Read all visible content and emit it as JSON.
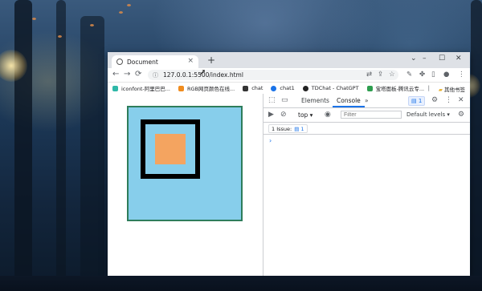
{
  "browser": {
    "tab_title": "Document",
    "new_tab": "+",
    "window_controls": {
      "minimize": "–",
      "maximize": "☐",
      "close": "✕"
    },
    "url": "127.0.0.1:5500/index.html",
    "nav": {
      "back": "←",
      "forward": "→",
      "reload": "⟳",
      "info": "ⓘ"
    }
  },
  "bookmarks": {
    "items": [
      {
        "label": "iconfont-阿里巴巴...",
        "color": "#2fb8a8"
      },
      {
        "label": "RGB网页颜色在线...",
        "color": "#f08c1e"
      },
      {
        "label": "chat",
        "color": "#333333"
      },
      {
        "label": "chat1",
        "color": "#1a73e8"
      },
      {
        "label": "TDChat - ChatGPT",
        "color": "#222222"
      },
      {
        "label": "宝塔面板-腾讯云专...",
        "color": "#2e9e4f"
      }
    ],
    "other": "其他书签"
  },
  "page": {
    "colors": {
      "outer": "#87ceeb",
      "outer_border": "#2e7d5b",
      "frame": "#000000",
      "inner": "#f4a460"
    }
  },
  "devtools": {
    "tabs": [
      "Elements",
      "Console"
    ],
    "active_tab": "Console",
    "more": "»",
    "issues_badge": "1",
    "context": "top ▾",
    "filter_placeholder": "Filter",
    "levels": "Default levels ▾",
    "issues_label": "1 Issue:",
    "issues_count": "1",
    "prompt": "›"
  }
}
